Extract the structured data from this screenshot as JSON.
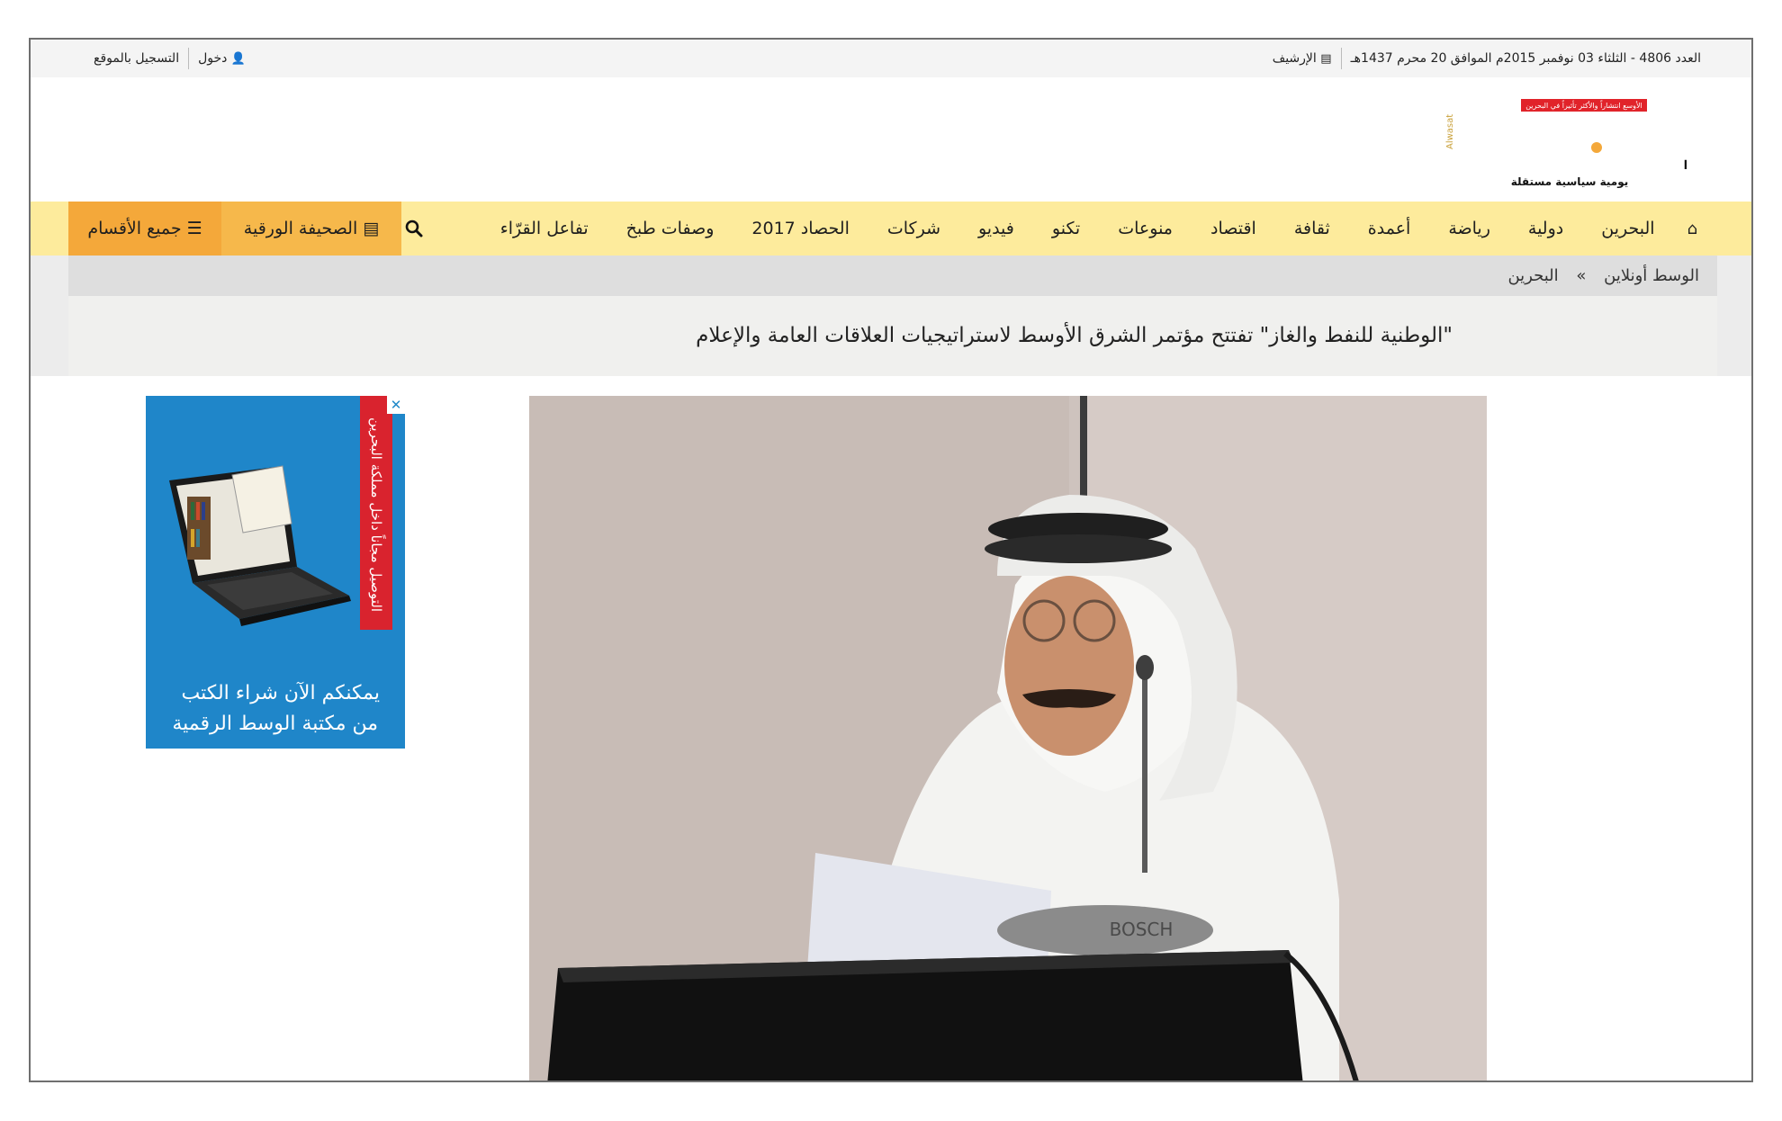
{
  "topbar": {
    "issue_date": "العدد 4806 - الثلثاء 03 نوفمبر 2015م الموافق 20 محرم 1437هـ",
    "archive": "الإرشيف",
    "login": "دخول",
    "register": "التسجيل بالموقع"
  },
  "logo": {
    "name": "الوسط",
    "latin": "Alwasat",
    "tagline": "يومية سياسية مستقلة",
    "banner": "الأوسع انتشاراً والأكثر تأثيراً في البحرين"
  },
  "nav": {
    "items": [
      "البحرين",
      "دولية",
      "رياضة",
      "أعمدة",
      "ثقافة",
      "اقتصاد",
      "منوعات",
      "تكنو",
      "فيديو",
      "شركات",
      "الحصاد 2017",
      "وصفات طبخ",
      "تفاعل القرّاء"
    ],
    "paper": "الصحيفة الورقية",
    "all_sections": "جميع الأقسام"
  },
  "breadcrumb": {
    "home": "الوسط أونلاين",
    "separator": "»",
    "current": "البحرين"
  },
  "article": {
    "title": "\"الوطنية للنفط والغاز\" تفتتح مؤتمر الشرق الأوسط لاستراتيجيات العلاقات العامة والإعلام"
  },
  "ad": {
    "ribbon": "التوصيل مجاناً داخل مملكة البحرين",
    "line1": "يمكنكم الآن شراء الكتب",
    "line2": "من مكتبة الوسط الرقمية",
    "close": "✕"
  },
  "photo": {
    "mic_brand": "BOSCH"
  },
  "colors": {
    "nav_bg": "#fdeb9c",
    "paper_btn": "#f6b84b",
    "all_btn": "#f4a83a",
    "logo_red": "#e1232a",
    "ad_blue": "#1f86c9"
  },
  "icons": [
    "home-icon",
    "search-icon",
    "newspaper-icon",
    "menu-icon",
    "user-icon",
    "close-icon"
  ]
}
